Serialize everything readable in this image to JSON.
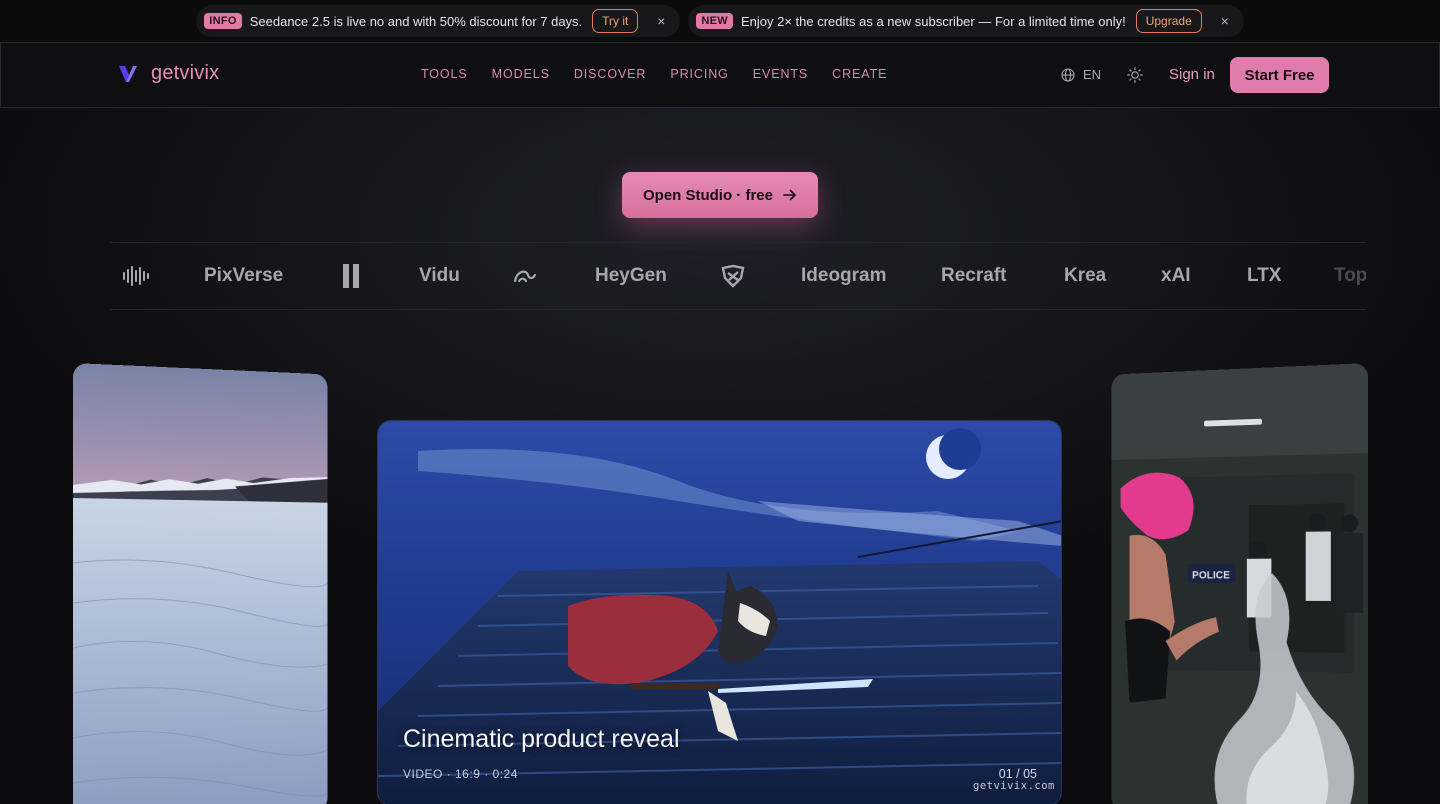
{
  "announcements": [
    {
      "tag": "INFO",
      "text": "Seedance 2.5 is live no and with 50% discount for 7 days.",
      "button": "Try it",
      "close": "×"
    },
    {
      "tag": "NEW",
      "text": "Enjoy 2× the credits as a new subscriber — For a limited time only!",
      "button": "Upgrade",
      "close": "×"
    }
  ],
  "nav": {
    "brand": "getvivix",
    "menu": [
      "TOOLS",
      "MODELS",
      "DISCOVER",
      "PRICING",
      "EVENTS",
      "CREATE"
    ],
    "language": "EN",
    "sign_in": "Sign in",
    "start_free": "Start Free"
  },
  "hero": {
    "cta": "Open Studio · free"
  },
  "partner_logos": [
    {
      "name": "PixVerse",
      "type": "text"
    },
    {
      "name": "Vidu",
      "type": "text"
    },
    {
      "name": "HeyGen",
      "type": "text"
    },
    {
      "name": "Ideogram",
      "type": "text"
    },
    {
      "name": "Recraft",
      "type": "text"
    },
    {
      "name": "Krea",
      "type": "text"
    },
    {
      "name": "xAI",
      "type": "text"
    },
    {
      "name": "LTX",
      "type": "text"
    },
    {
      "name": "Top",
      "type": "text"
    }
  ],
  "partner_icons": [
    "waveform-logo-icon",
    "bars-logo-icon",
    "swirl-logo-icon",
    "shield-logo-icon"
  ],
  "showcase": {
    "title": "Cinematic product reveal",
    "meta": "VIDEO · 16:9 · 0:24",
    "counter": "01 / 05",
    "watermark": "getvivix.com"
  },
  "colors": {
    "accent_pink": "#e07cab",
    "tag_pink": "#e07aa6",
    "button_orange": "#e8785a",
    "brand_purple": "#7b5cf2"
  }
}
